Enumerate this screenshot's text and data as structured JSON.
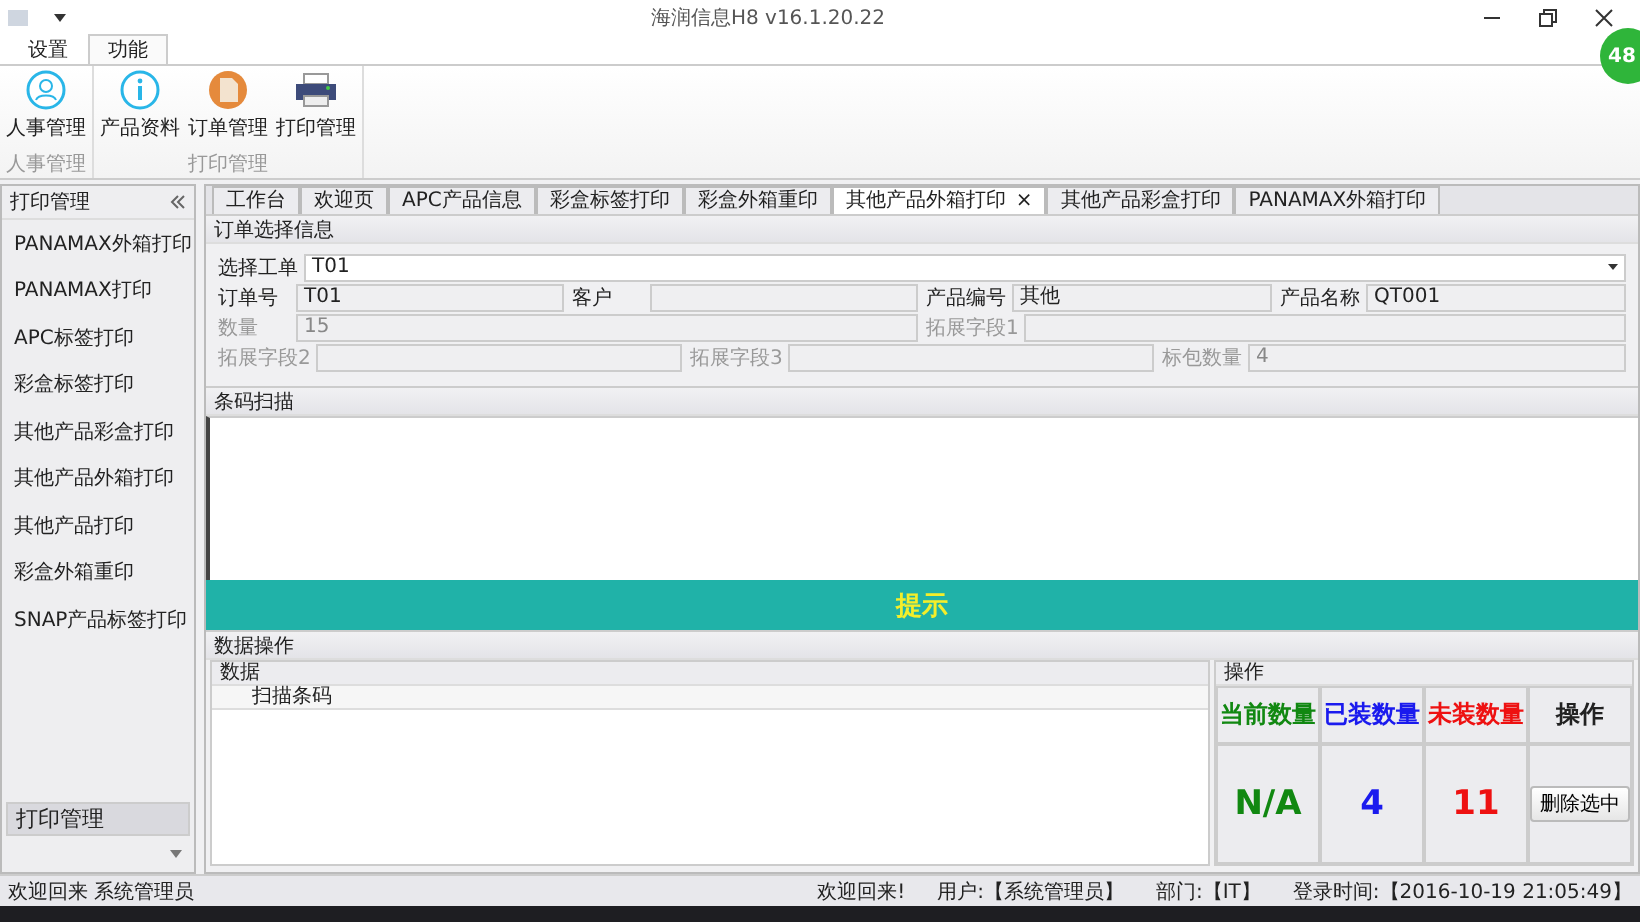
{
  "window": {
    "title": "海润信息H8 v16.1.20.22",
    "badge": "48"
  },
  "ribbon_tabs": [
    {
      "label": "设置",
      "selected": false
    },
    {
      "label": "功能",
      "selected": true
    }
  ],
  "ribbon_groups": [
    {
      "title": "人事管理",
      "buttons": [
        {
          "label": "人事管理",
          "kind": "person"
        }
      ]
    },
    {
      "title": "打印管理",
      "buttons": [
        {
          "label": "产品资料",
          "kind": "info"
        },
        {
          "label": "订单管理",
          "kind": "document"
        },
        {
          "label": "打印管理",
          "kind": "printer"
        }
      ]
    }
  ],
  "sidebar": {
    "title": "打印管理",
    "items": [
      {
        "label": "PANAMAX外箱打印"
      },
      {
        "label": "PANAMAX打印"
      },
      {
        "label": "APC标签打印"
      },
      {
        "label": "彩盒标签打印"
      },
      {
        "label": "其他产品彩盒打印"
      },
      {
        "label": "其他产品外箱打印"
      },
      {
        "label": "其他产品打印"
      },
      {
        "label": "彩盒外箱重印"
      },
      {
        "label": "SNAP产品标签打印"
      }
    ],
    "footer": "打印管理"
  },
  "doc_tabs": [
    {
      "label": "工作台",
      "selected": false
    },
    {
      "label": "欢迎页",
      "selected": false
    },
    {
      "label": "APC产品信息",
      "selected": false
    },
    {
      "label": "彩盒标签打印",
      "selected": false
    },
    {
      "label": "彩盒外箱重印",
      "selected": false
    },
    {
      "label": "其他产品外箱打印",
      "selected": true,
      "close": "×"
    },
    {
      "label": "其他产品彩盒打印",
      "selected": false
    },
    {
      "label": "PANAMAX外箱打印",
      "selected": false
    }
  ],
  "order_section": {
    "title": "订单选择信息",
    "rows": [
      {
        "disabled": false,
        "fields": [
          {
            "label": "选择工单",
            "value": "T01",
            "kind": "dropdown"
          }
        ]
      },
      {
        "disabled": false,
        "fields": [
          {
            "label": "订单号",
            "value": "T01"
          },
          {
            "label": "客户"
          },
          {
            "label": "产品编号",
            "value": "其他"
          },
          {
            "label": "产品名称",
            "value": "QT001"
          }
        ]
      },
      {
        "disabled": true,
        "fields": [
          {
            "label": "数量",
            "value": "15"
          },
          {
            "label": "拓展字段1"
          }
        ]
      },
      {
        "disabled": true,
        "fields": [
          {
            "label": "拓展字段2"
          },
          {
            "label": "拓展字段3"
          },
          {
            "label": "标包数量",
            "value": "4"
          }
        ]
      }
    ]
  },
  "scan_section": {
    "title": "条码扫描",
    "banner": "提示"
  },
  "data_section": {
    "title": "数据操作",
    "data_panel": {
      "title": "数据",
      "columns": [
        "扫描条码"
      ]
    },
    "ops_panel": {
      "title": "操作",
      "stats": [
        {
          "header": "当前数量",
          "value": "N/A",
          "color": "#118811"
        },
        {
          "header": "已装数量",
          "value": "4",
          "color": "#1a1aee"
        },
        {
          "header": "未装数量",
          "value": "11",
          "color": "#ee1111"
        }
      ],
      "action_header": "操作",
      "action_button": "删除选中"
    }
  },
  "status_bar": {
    "left": "欢迎回来 系统管理员",
    "items": [
      "欢迎回来!",
      "用户:【系统管理员】",
      "部门:【IT】",
      "登录时间:【2016-10-19 21:05:49】"
    ]
  }
}
